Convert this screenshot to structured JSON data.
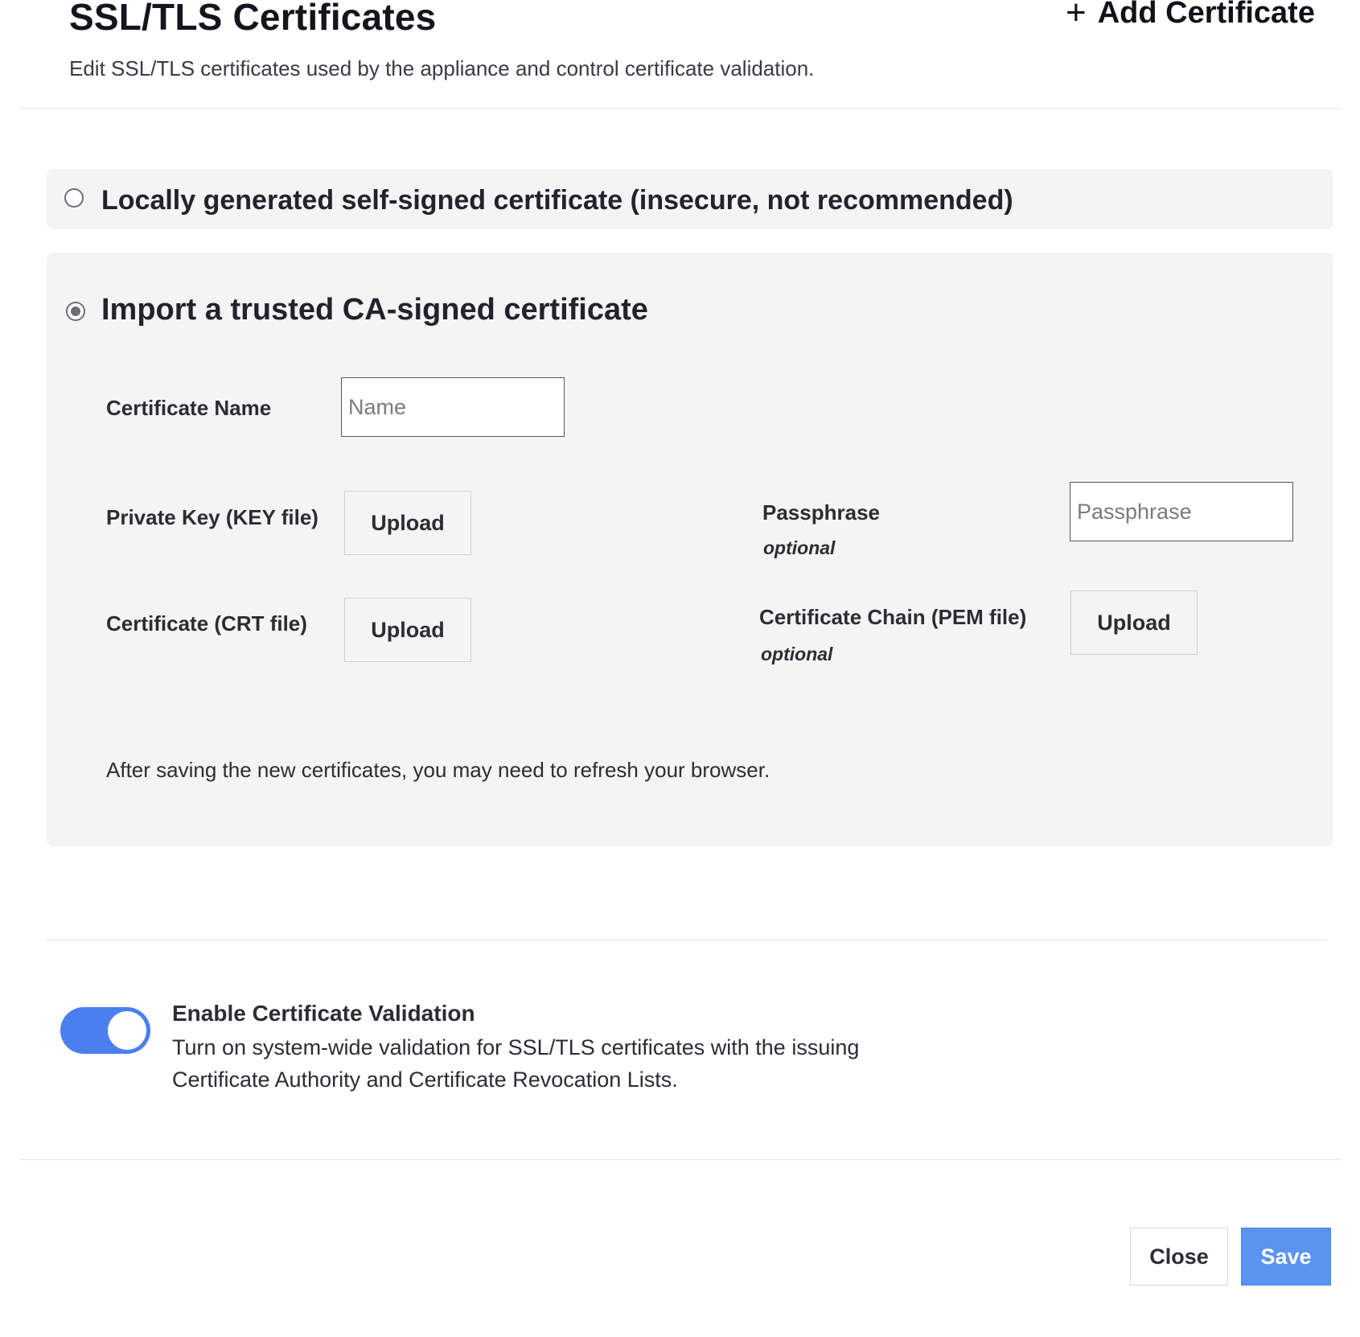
{
  "header": {
    "title": "SSL/TLS Certificates",
    "subtitle": "Edit SSL/TLS certificates used by the appliance and control certificate validation.",
    "add_certificate_label": "Add Certificate",
    "add_icon": "plus-icon"
  },
  "options": {
    "self_signed": {
      "label": "Locally generated self-signed certificate (insecure, not recommended)",
      "selected": false
    },
    "import_ca": {
      "label": "Import a trusted CA-signed certificate",
      "selected": true,
      "certificate_name": {
        "label": "Certificate Name",
        "placeholder": "Name",
        "value": ""
      },
      "private_key": {
        "label": "Private Key (KEY file)",
        "button": "Upload"
      },
      "certificate": {
        "label": "Certificate (CRT file)",
        "button": "Upload"
      },
      "passphrase": {
        "label": "Passphrase",
        "hint": "optional",
        "placeholder": "Passphrase",
        "value": ""
      },
      "certificate_chain": {
        "label": "Certificate Chain (PEM file)",
        "hint": "optional",
        "button": "Upload"
      },
      "note": "After saving the new certificates, you may need to refresh your browser."
    }
  },
  "validation": {
    "enabled": true,
    "title": "Enable Certificate Validation",
    "description": "Turn on system-wide validation for SSL/TLS certificates with the issuing Certificate Authority and Certificate Revocation Lists.",
    "accent_color": "#4a7ff0"
  },
  "footer": {
    "close_label": "Close",
    "save_label": "Save",
    "save_color": "#5b93f0"
  }
}
